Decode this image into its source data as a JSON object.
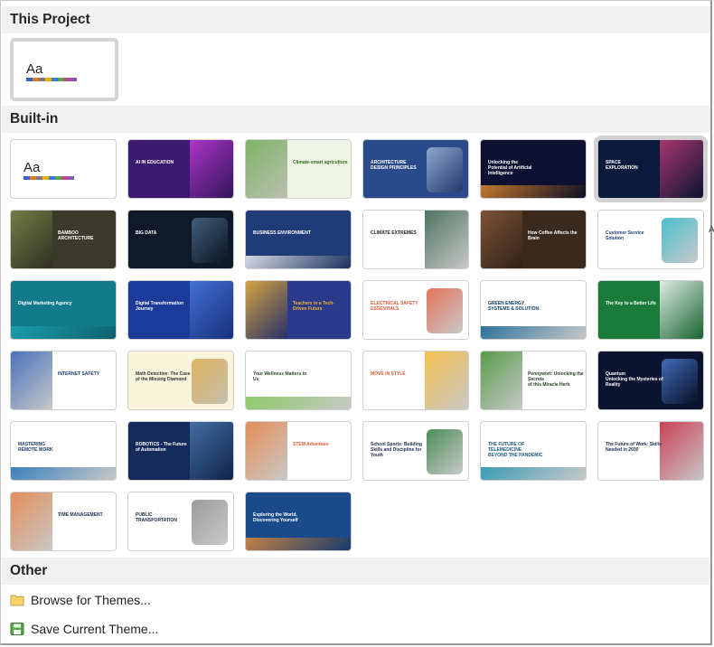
{
  "sections": {
    "this_project": "This Project",
    "built_in": "Built-in",
    "other": "Other"
  },
  "default_theme": {
    "sample_text": "Aa"
  },
  "swatch_colors": [
    "#3a5fcd",
    "#e07a2a",
    "#7a7a7a",
    "#e8b400",
    "#3d7bd4",
    "#5aa64b",
    "#c04a8c",
    "#8a5ab0"
  ],
  "themes": [
    {
      "title": "AI IN EDUCATION",
      "bg": "#3a1a6e",
      "accent": "#c23ad8",
      "fg": "#ffffff"
    },
    {
      "title": "Climate-smart agriculture",
      "bg": "#eef4e3",
      "accent": "#6aa84f",
      "fg": "#2e6b1f"
    },
    {
      "title": "ARCHITECTURE\nDESIGN PRINCIPLES",
      "bg": "#2b4a8c",
      "accent": "#9fb6d8",
      "fg": "#ffffff"
    },
    {
      "title": "Unlocking the\nPotential of Artificial\nIntelligence",
      "bg": "#0d1030",
      "accent": "#e08a2c",
      "fg": "#ffffff"
    },
    {
      "title": "SPACE\nEXPLORATION",
      "bg": "#0b1a3a",
      "accent": "#c33a7a",
      "fg": "#ffffff"
    },
    {
      "title": "BAMBOO\nARCHITECTURE",
      "bg": "#3b3a2a",
      "accent": "#7b8a4a",
      "fg": "#ffffff"
    },
    {
      "title": "BIG DATA",
      "bg": "#0e1a2a",
      "accent": "#4a6a8a",
      "fg": "#ffffff"
    },
    {
      "title": "BUSINESS ENVIRONMENT",
      "bg": "#1f3b78",
      "accent": "#f4f4f4",
      "fg": "#ffffff"
    },
    {
      "title": "CLIMATE EXTREMES",
      "bg": "#ffffff",
      "accent": "#2f5b44",
      "fg": "#222222"
    },
    {
      "title": "How Coffee Affects the\nBrain",
      "bg": "#3a2a1e",
      "accent": "#8a5a3a",
      "fg": "#ffffff"
    },
    {
      "title": "Customer Service\nSolution",
      "bg": "#ffffff",
      "accent": "#2ab3c6",
      "fg": "#1f3b78"
    },
    {
      "title": "Digital Marketing Agency",
      "bg": "#127a8a",
      "accent": "#1aa3b0",
      "fg": "#ffffff"
    },
    {
      "title": "Digital Transformation Journey",
      "bg": "#1c3a9a",
      "accent": "#4a7ae0",
      "fg": "#ffffff"
    },
    {
      "title": "Teachers in a Tech-\nDriven Future",
      "bg": "#2b3a8a",
      "accent": "#f2b531",
      "fg": "#f2b531"
    },
    {
      "title": "ELECTRICAL SAFETY\nESSENTIALS",
      "bg": "#ffffff",
      "accent": "#e05a3a",
      "fg": "#e05a3a"
    },
    {
      "title": "GREEN ENERGY\nSYSTEMS & SOLUTION",
      "bg": "#ffffff",
      "accent": "#0a5a8a",
      "fg": "#0a3a6a"
    },
    {
      "title": "The Key to a Better Life",
      "bg": "#1a7a3a",
      "accent": "#ffffff",
      "fg": "#ffffff"
    },
    {
      "title": "INTERNET SAFETY",
      "bg": "#ffffff",
      "accent": "#2a5ab0",
      "fg": "#1f3b78"
    },
    {
      "title": "Math Detective: The Case of the Missing Diamond",
      "bg": "#fbf4dd",
      "accent": "#d8a84a",
      "fg": "#333333"
    },
    {
      "title": "Your Wellness Matters to Us",
      "bg": "#ffffff",
      "accent": "#7ac04a",
      "fg": "#2a4a2a"
    },
    {
      "title": "MOVE IN STYLE",
      "bg": "#ffffff",
      "accent": "#f2b531",
      "fg": "#e05a3a"
    },
    {
      "title": "Pennywort: Unlocking the Secrets\nof this Miracle Herb",
      "bg": "#ffffff",
      "accent": "#3a8a2a",
      "fg": "#1f3a1f"
    },
    {
      "title": "Quantum\nUnlocking the Mysteries of Reality",
      "bg": "#0a1430",
      "accent": "#4a7ad0",
      "fg": "#ffffff"
    },
    {
      "title": "MASTERING\nREMOTE WORK",
      "bg": "#ffffff",
      "accent": "#1a6ab0",
      "fg": "#1a3a6a"
    },
    {
      "title": "ROBOTICS - The Future\nof Automation",
      "bg": "#132a5a",
      "accent": "#4a7ab0",
      "fg": "#ffffff"
    },
    {
      "title": "STEM Adventure",
      "bg": "#ffffff",
      "accent": "#e07a3a",
      "fg": "#e05a3a"
    },
    {
      "title": "School Sports: Building\nSkills and Discipline for\nYouth",
      "bg": "#ffffff",
      "accent": "#2a7a3a",
      "fg": "#1a2a4a"
    },
    {
      "title": "THE FUTURE OF\nTELEMEDICINE\nBEYOND THE PANDEMIC",
      "bg": "#ffffff",
      "accent": "#1a8aa8",
      "fg": "#1a5a8a"
    },
    {
      "title": "The Future of Work: Skills\nNeeded in 2030",
      "bg": "#ffffff",
      "accent": "#c0203a",
      "fg": "#1a2a4a"
    },
    {
      "title": "TIME MANAGEMENT",
      "bg": "#ffffff",
      "accent": "#e07a3a",
      "fg": "#1a2a4a"
    },
    {
      "title": "PUBLIC TRANSPORTATION",
      "bg": "#ffffff",
      "accent": "#8a8a8a",
      "fg": "#1a2a4a"
    },
    {
      "title": "Exploring the World,\nDiscovering Yourself",
      "bg": "#1a4a8a",
      "accent": "#e08a3a",
      "fg": "#ffffff"
    }
  ],
  "other_items": {
    "browse": "Browse for Themes...",
    "save": "Save Current Theme..."
  }
}
